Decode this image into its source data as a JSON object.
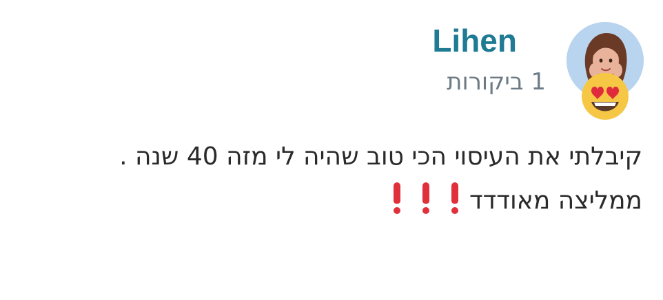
{
  "review": {
    "author_name": "Lihen",
    "review_count": "1 ביקורות",
    "body_line1": "קיבלתי את העיסוי הכי טוב שהיה לי מזה 40 שנה .",
    "body_line2": "ממליצה מאודדד",
    "emphasis_icons": [
      "exclamation-icon",
      "exclamation-icon",
      "exclamation-icon"
    ],
    "reaction_icon": "heart-eyes-emoji-icon"
  },
  "colors": {
    "name": "#1f7a93",
    "meta": "#6d7b86",
    "body_text": "#2a2a2a",
    "avatar_bg": "#b9d4ef",
    "emoji_yellow": "#f6c744",
    "exclamation": "#e0303b"
  }
}
